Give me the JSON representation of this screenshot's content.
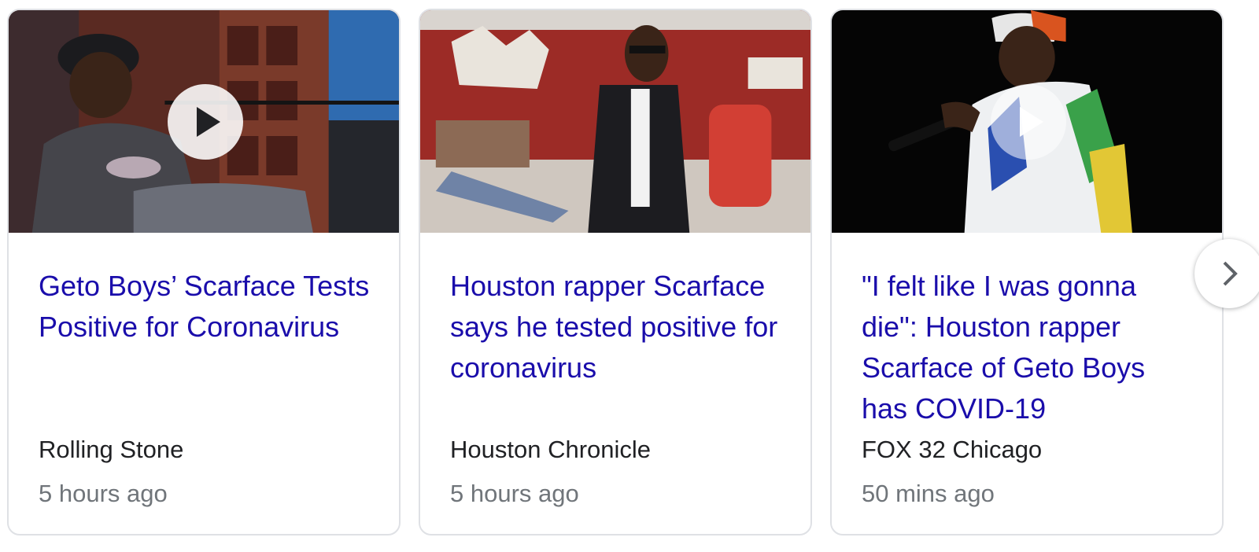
{
  "cards": [
    {
      "title": "Geto Boys’ Scarface Tests Positive for Coronavirus",
      "source": "Rolling Stone",
      "time": "5 hours ago",
      "has_video": true
    },
    {
      "title": "Houston rapper Scarface says he tested positive for coronavirus",
      "source": "Houston Chronicle",
      "time": "5 hours ago",
      "has_video": false
    },
    {
      "title": "\"I felt like I was gonna die\": Houston rapper Scarface of Geto Boys has COVID-19",
      "source": "FOX 32 Chicago",
      "time": "50 mins ago",
      "has_video": true
    }
  ],
  "icons": {
    "play": "play-icon",
    "next": "chevron-right-icon"
  },
  "colors": {
    "title_link": "#1a0dab",
    "source_text": "#202124",
    "time_text": "#70757a",
    "card_border": "#dfe1e5"
  }
}
